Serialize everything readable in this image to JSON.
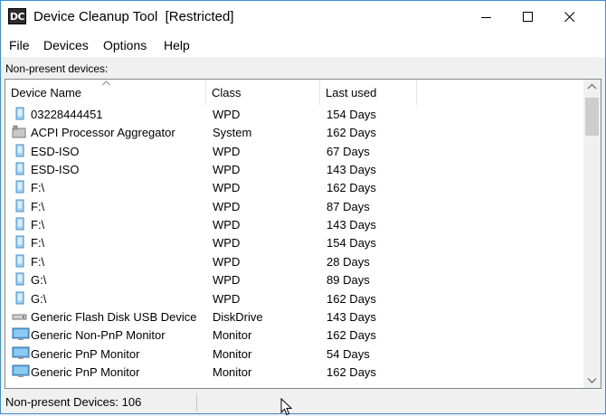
{
  "window": {
    "title": "Device Cleanup Tool  [Restricted]",
    "app_icon_text": "DC"
  },
  "menu": [
    "File",
    "Devices",
    "Options",
    "Help"
  ],
  "section_label": "Non-present devices:",
  "table": {
    "columns": [
      "Device Name",
      "Class",
      "Last used"
    ],
    "sorted_column": "Device Name",
    "rows": [
      {
        "icon": "portable-device-icon",
        "name": "03228444451",
        "class": "WPD",
        "last_used": "154 Days"
      },
      {
        "icon": "processor-icon",
        "name": "ACPI Processor Aggregator",
        "class": "System",
        "last_used": "162 Days"
      },
      {
        "icon": "portable-device-icon",
        "name": "ESD-ISO",
        "class": "WPD",
        "last_used": "67 Days"
      },
      {
        "icon": "portable-device-icon",
        "name": "ESD-ISO",
        "class": "WPD",
        "last_used": "143 Days"
      },
      {
        "icon": "portable-device-icon",
        "name": "F:\\",
        "class": "WPD",
        "last_used": "162 Days"
      },
      {
        "icon": "portable-device-icon",
        "name": "F:\\",
        "class": "WPD",
        "last_used": "87 Days"
      },
      {
        "icon": "portable-device-icon",
        "name": "F:\\",
        "class": "WPD",
        "last_used": "143 Days"
      },
      {
        "icon": "portable-device-icon",
        "name": "F:\\",
        "class": "WPD",
        "last_used": "154 Days"
      },
      {
        "icon": "portable-device-icon",
        "name": "F:\\",
        "class": "WPD",
        "last_used": "28 Days"
      },
      {
        "icon": "portable-device-icon",
        "name": "G:\\",
        "class": "WPD",
        "last_used": "89 Days"
      },
      {
        "icon": "portable-device-icon",
        "name": "G:\\",
        "class": "WPD",
        "last_used": "162 Days"
      },
      {
        "icon": "disk-drive-icon",
        "name": "Generic Flash Disk USB Device",
        "class": "DiskDrive",
        "last_used": "143 Days"
      },
      {
        "icon": "monitor-icon",
        "name": "Generic Non-PnP Monitor",
        "class": "Monitor",
        "last_used": "162 Days"
      },
      {
        "icon": "monitor-icon",
        "name": "Generic PnP Monitor",
        "class": "Monitor",
        "last_used": "54 Days"
      },
      {
        "icon": "monitor-icon",
        "name": "Generic PnP Monitor",
        "class": "Monitor",
        "last_used": "162 Days"
      }
    ]
  },
  "status": {
    "text": "Non-present Devices: 106"
  },
  "colors": {
    "window_border": "#3b8ed8",
    "icon_blue": "#5aa9e6"
  }
}
